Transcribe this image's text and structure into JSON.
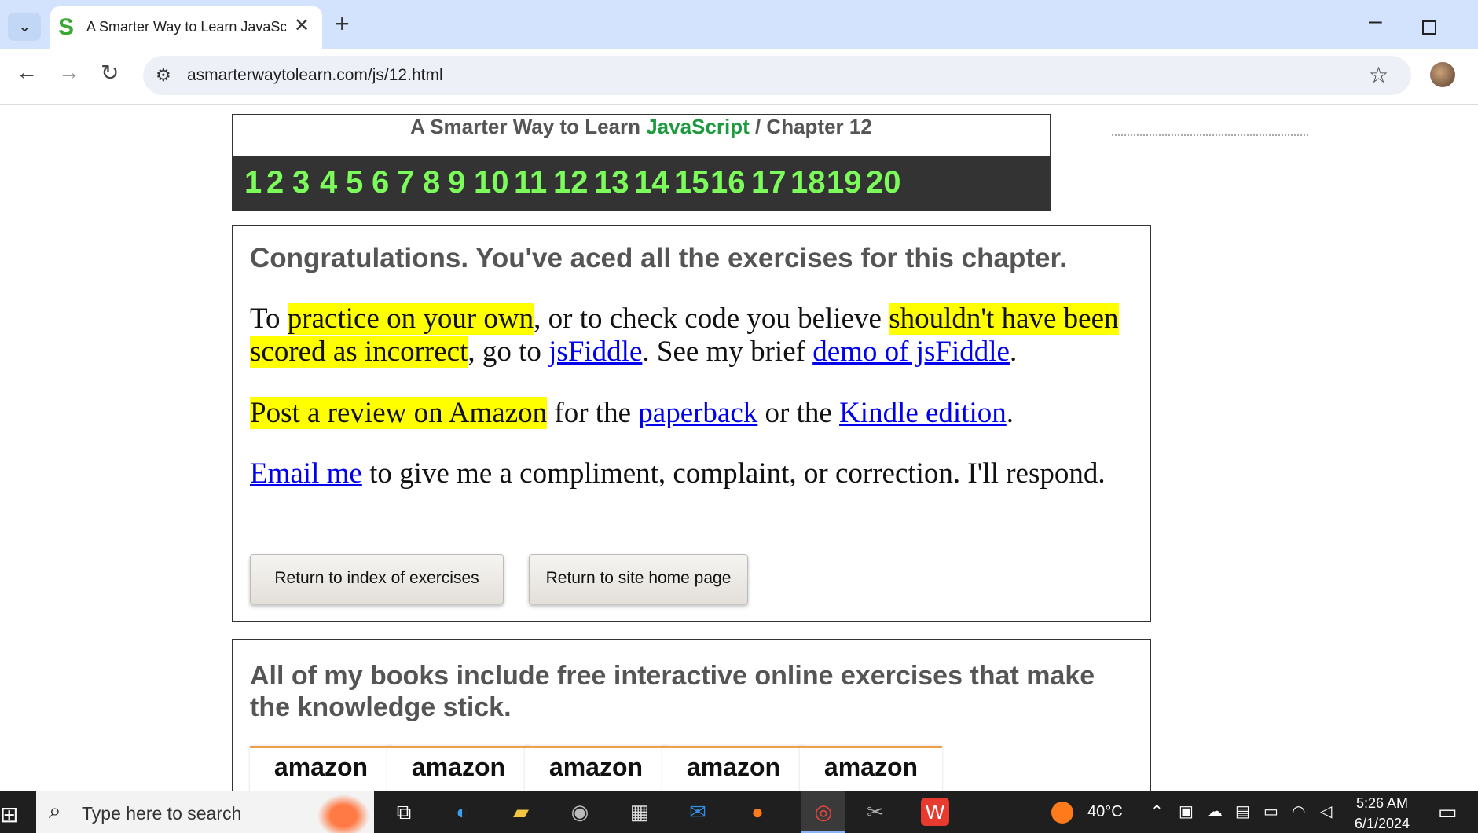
{
  "browser": {
    "tab_title": "A Smarter Way to Learn JavaScript",
    "tab_favicon": "S",
    "new_tab_label": "+",
    "url": "asmarterwaytolearn.com/js/12.html"
  },
  "header": {
    "title_prefix": "A Smarter Way to Learn ",
    "title_accent": "JavaScript",
    "title_separator": " / ",
    "title_chapter": "Chapter 12",
    "chapters": [
      "1",
      "2",
      "3",
      "4",
      "5",
      "6",
      "7",
      "8",
      "9",
      "10",
      "11",
      "12",
      "13",
      "14",
      "15",
      "16",
      "17",
      "18",
      "19",
      "20"
    ]
  },
  "congrats": {
    "heading": "Congratulations. You've aced all the exercises for this chapter.",
    "p1": {
      "t1": "To ",
      "h1": "practice on your own",
      "t2": ", or to check code you believe ",
      "h2": "shouldn't have been scored as incorrect",
      "t3": ", go to ",
      "l1": "jsFiddle",
      "t4": ". See my brief ",
      "l2": "demo of jsFiddle",
      "t5": "."
    },
    "p2": {
      "h1": "Post a review on Amazon",
      "t1": " for the ",
      "l1": "paperback",
      "t2": " or the ",
      "l2": "Kindle edition",
      "t3": "."
    },
    "p3": {
      "l1": "Email me",
      "t1": " to give me a compliment, complaint, or correction. I'll respond."
    },
    "buttons": {
      "index": "Return to index of exercises",
      "home": "Return to site home page"
    }
  },
  "books": {
    "heading": "All of my books include free interactive online exercises that make the knowledge stick.",
    "cards": [
      "amazon",
      "amazon",
      "amazon",
      "amazon",
      "amazon"
    ]
  },
  "taskbar": {
    "search_placeholder": "Type here to search",
    "weather": "40°C",
    "time": "5:26 AM",
    "date": "6/1/2024"
  },
  "colors": {
    "accent_green": "#1d9a3e",
    "chapter_green": "#7cfc5a",
    "highlight": "#ffff00",
    "link": "#0000ee"
  }
}
